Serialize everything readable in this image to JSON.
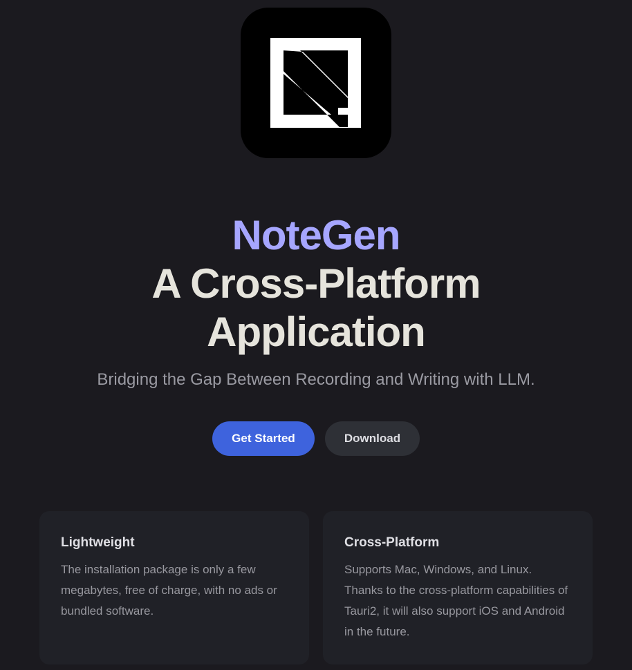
{
  "colors": {
    "background": "#1b1a1f",
    "brand": "#a6a6ff",
    "headline": "#e6e4dc",
    "tagline": "#9a9aa2",
    "primary_button": "#3e63dd",
    "primary_button_text": "#ffffff",
    "secondary_button": "#2e3036",
    "secondary_button_text": "#dedee3",
    "card_background": "#202127",
    "card_title": "#dfdfe4",
    "card_text": "#98989f",
    "logo_background": "#000000",
    "logo_mark": "#ffffff"
  },
  "logo": {
    "icon": "notegen-logo-icon"
  },
  "hero": {
    "brand": "NoteGen",
    "headline_line1": "A Cross-Platform",
    "headline_line2": "Application",
    "tagline": "Bridging the Gap Between Recording and Writing with LLM."
  },
  "actions": {
    "get_started_label": "Get Started",
    "download_label": "Download"
  },
  "features": [
    {
      "title": "Lightweight",
      "description": "The installation package is only a few megabytes, free of charge, with no ads or bundled software."
    },
    {
      "title": "Cross-Platform",
      "description": "Supports Mac, Windows, and Linux. Thanks to the cross-platform capabilities of Tauri2, it will also support iOS and Android in the future."
    }
  ]
}
